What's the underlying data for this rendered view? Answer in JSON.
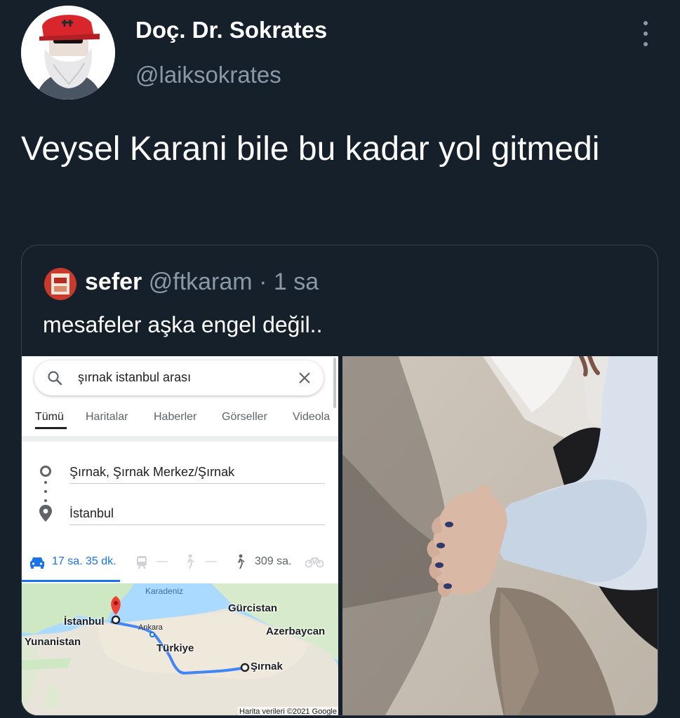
{
  "tweet": {
    "author_name": "Doç. Dr. Sokrates",
    "author_handle": "@laiksokrates",
    "text": "Veysel Karani bile bu kadar yol gitmedi"
  },
  "quote": {
    "author_name": "sefer",
    "author_handle": "@ftkaram",
    "separator": "·",
    "time": "1 sa",
    "text": "mesafeler aşka engel değil.."
  },
  "maps": {
    "search_query": "şırnak istanbul arası",
    "tabs": [
      "Tümü",
      "Haritalar",
      "Haberler",
      "Görseller",
      "Videola"
    ],
    "active_tab": "Tümü",
    "origin": "Şırnak, Şırnak Merkez/Şırnak",
    "destination": "İstanbul",
    "drive_time": "17 sa. 35 dk.",
    "dash_transit": "—",
    "dash_bike_walk": "—",
    "walk_time": "309 sa.",
    "map_labels": {
      "sea": "Karadeniz",
      "georgia": "Gürcistan",
      "istanbul": "İstanbul",
      "ankara": "Ankara",
      "azerbaijan": "Azerbaycan",
      "greece": "Yunanistan",
      "turkey": "Türkiye",
      "sirnak": "Şırnak"
    },
    "credit": "Harita verileri ©2021 Google"
  },
  "colors": {
    "background": "#15202b",
    "secondary_text": "#8b98a5",
    "border": "#38444d",
    "maps_blue": "#1a73e8",
    "route_blue": "#4285f4",
    "pin_red": "#ea4335",
    "cap_red": "#d9262c"
  }
}
